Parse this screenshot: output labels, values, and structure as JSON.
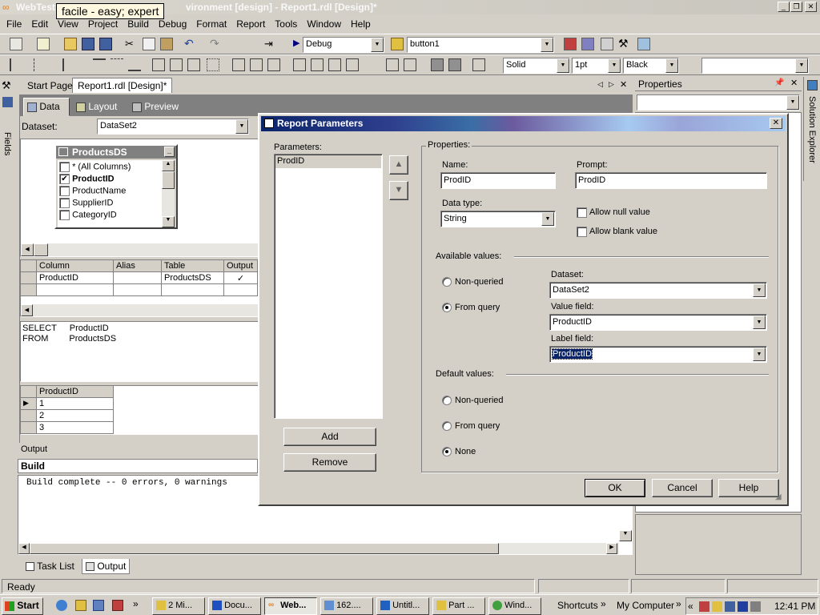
{
  "window": {
    "title": "WebTest - Microsoft Development Environment [design] - Report1.rdl [Design]*",
    "title_visible": "vironment [design] - Report1.rdl [Design]*",
    "title_prefix": "WebTest",
    "tooltip": "facile - easy; expert",
    "min_glyph": "_",
    "max_glyph": "❐",
    "close_glyph": "✕"
  },
  "menu": [
    "File",
    "Edit",
    "View",
    "Project",
    "Build",
    "Debug",
    "Format",
    "Report",
    "Tools",
    "Window",
    "Help"
  ],
  "toolbar1": {
    "config": "Debug",
    "find": "button1"
  },
  "toolbar2": {
    "line_style": "Solid",
    "line_width": "1pt",
    "color": "Black",
    "font": ""
  },
  "tabs": [
    "Start Page",
    "Report1.rdl [Design]*"
  ],
  "subtabs": [
    "Data",
    "Layout",
    "Preview"
  ],
  "dataset_label": "Dataset:",
  "dataset_value": "DataSet2",
  "fields_tab": "Fields",
  "table_box": {
    "title": "ProductsDS",
    "columns": [
      {
        "name": "* (All Columns)",
        "checked": false,
        "bold": false
      },
      {
        "name": "ProductID",
        "checked": true,
        "bold": true
      },
      {
        "name": "ProductName",
        "checked": false,
        "bold": false
      },
      {
        "name": "SupplierID",
        "checked": false,
        "bold": false
      },
      {
        "name": "CategoryID",
        "checked": false,
        "bold": false
      }
    ]
  },
  "grid": {
    "headers": [
      "Column",
      "Alias",
      "Table",
      "Output"
    ],
    "row": [
      "ProductID",
      "",
      "ProductsDS",
      "✓"
    ]
  },
  "sql": {
    "line1_kw": "SELECT",
    "line1_val": "ProductID",
    "line2_kw": "FROM",
    "line2_val": "ProductsDS"
  },
  "results": {
    "header": "ProductID",
    "rows": [
      "1",
      "2",
      "3"
    ]
  },
  "output": {
    "title": "Output",
    "combo": "Build",
    "text": "Build complete -- 0 errors, 0 warnings"
  },
  "bottom_tabs": [
    "Task List",
    "Output"
  ],
  "properties": {
    "title": "Properties"
  },
  "solution_explorer": "Solution Explorer",
  "status": "Ready",
  "dialog": {
    "title": "Report Parameters",
    "parameters_label": "Parameters:",
    "parameters": [
      "ProdID"
    ],
    "add": "Add",
    "remove": "Remove",
    "properties_label": "Properties:",
    "name_label": "Name:",
    "name_value": "ProdID",
    "prompt_label": "Prompt:",
    "prompt_value": "ProdID",
    "datatype_label": "Data type:",
    "datatype_value": "String",
    "allow_null": "Allow null value",
    "allow_blank": "Allow blank value",
    "available_label": "Available values:",
    "avail_nonqueried": "Non-queried",
    "avail_fromquery": "From query",
    "ds_label": "Dataset:",
    "ds_value": "DataSet2",
    "value_field_label": "Value field:",
    "value_field": "ProductID",
    "label_field_label": "Label field:",
    "label_field": "ProductID",
    "default_label": "Default values:",
    "def_nonqueried": "Non-queried",
    "def_fromquery": "From query",
    "def_none": "None",
    "ok": "OK",
    "cancel": "Cancel",
    "help": "Help"
  },
  "taskbar": {
    "start": "Start",
    "tasks": [
      "2 Mi...",
      "Docu...",
      "Web...",
      "162....",
      "Untitl...",
      "Part ...",
      "Wind..."
    ],
    "shortcuts": "Shortcuts",
    "mycomputer": "My Computer",
    "clock": "12:41 PM"
  }
}
